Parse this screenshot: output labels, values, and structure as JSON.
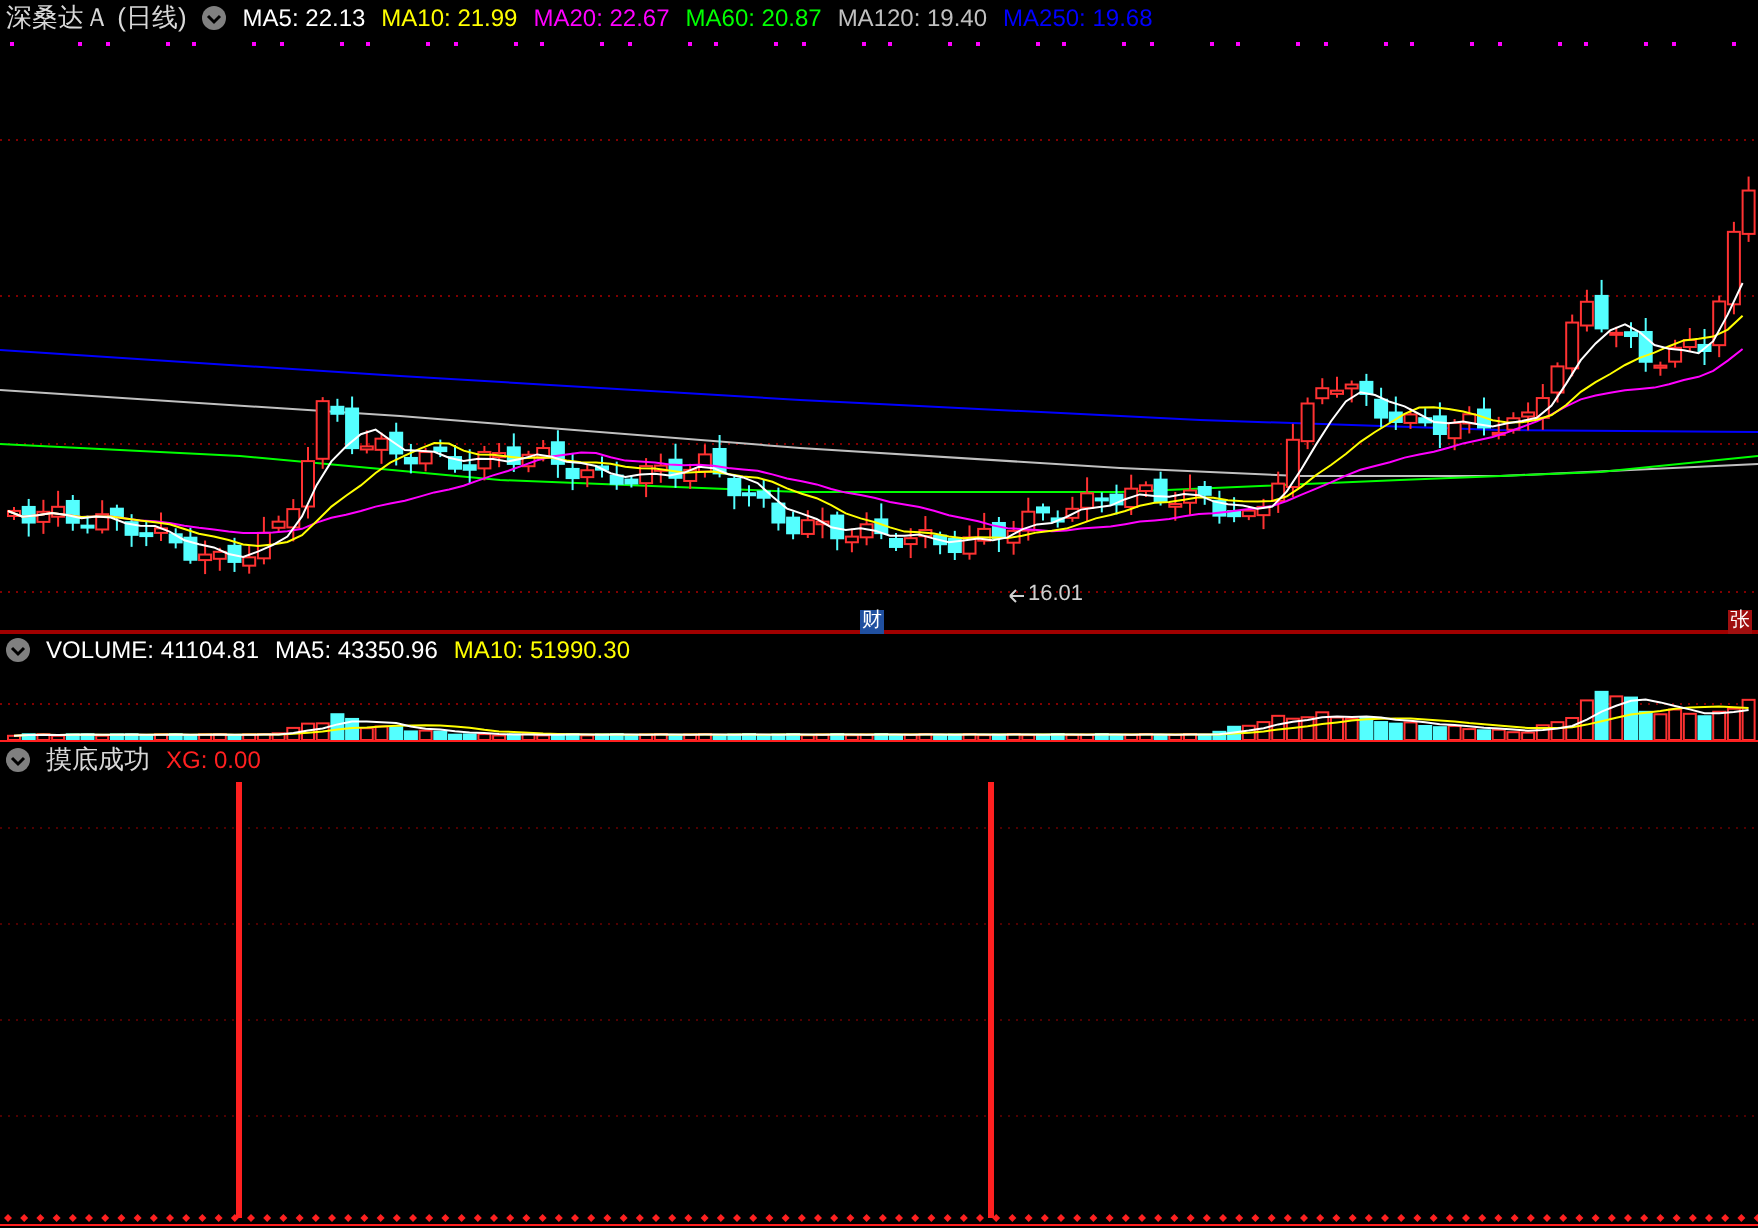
{
  "header": {
    "title": "深桑达Ａ",
    "period": "(日线)"
  },
  "price_legend": [
    {
      "label": "MA5: 22.13",
      "color": "#ffffff"
    },
    {
      "label": "MA10: 21.99",
      "color": "#ffff00"
    },
    {
      "label": "MA20: 22.67",
      "color": "#ff00ff"
    },
    {
      "label": "MA60: 20.87",
      "color": "#00ff00"
    },
    {
      "label": "MA120: 19.40",
      "color": "#c0c0c0"
    },
    {
      "label": "MA250: 19.68",
      "color": "#0000ff"
    }
  ],
  "price_chart": {
    "low_label": "16.01",
    "finance_marker": "财",
    "limit_marker": "张"
  },
  "volume_legend": [
    {
      "label": "VOLUME: 41104.81",
      "color": "#ffffff"
    },
    {
      "label": "MA5: 43350.96",
      "color": "#ffffff"
    },
    {
      "label": "MA10: 51990.30",
      "color": "#ffff00"
    }
  ],
  "indicator": {
    "name": "摸底成功",
    "value": "XG: 0.00"
  }
}
